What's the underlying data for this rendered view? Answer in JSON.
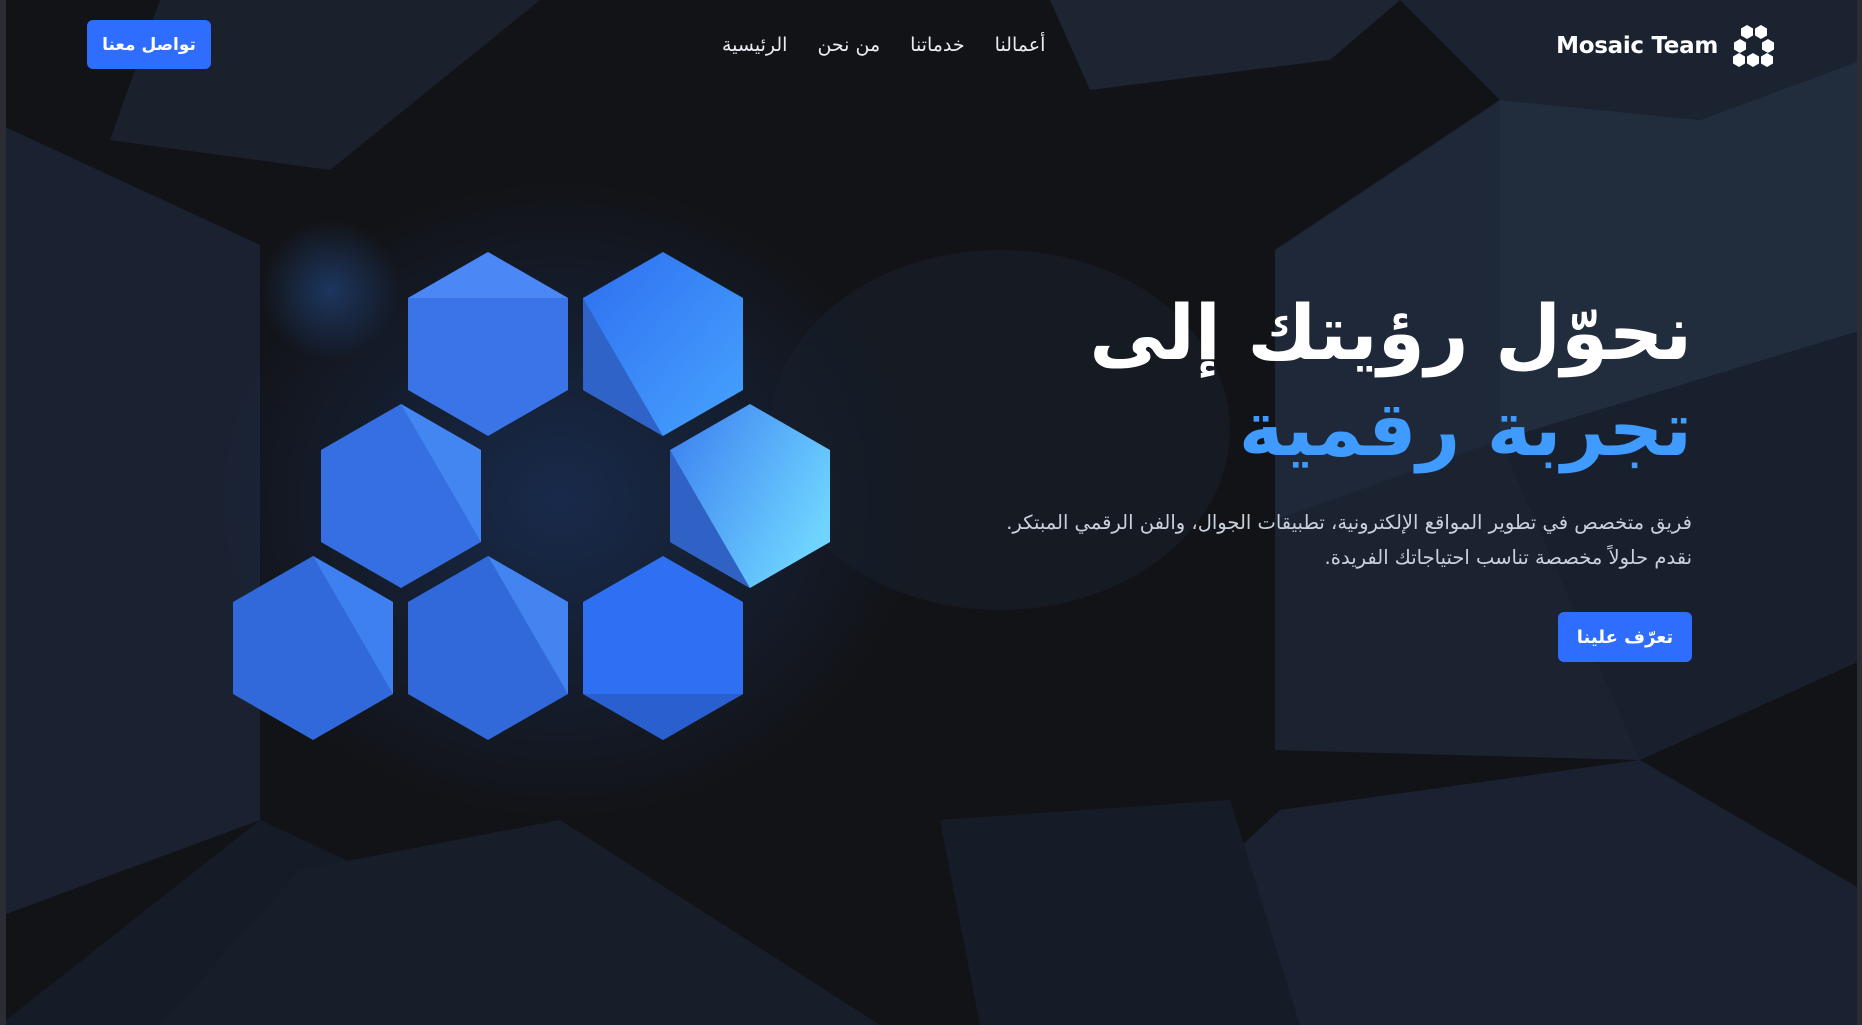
{
  "brand": {
    "name": "Mosaic Team",
    "logo_icon": "hexagon-cluster-icon"
  },
  "nav": {
    "links": [
      {
        "label": "الرئيسية"
      },
      {
        "label": "من نحن"
      },
      {
        "label": "خدماتنا"
      },
      {
        "label": "أعمالنا"
      }
    ],
    "contact_label": "تواصل معنا"
  },
  "hero": {
    "title_line1": "نحوّل رؤيتك إلى",
    "title_line2": "تجربة رقمية",
    "description": "فريق متخصص في تطوير المواقع الإلكترونية، تطبيقات الجوال، والفن الرقمي المبتكر. نقدم حلولاً مخصصة تناسب احتياجاتك الفريدة.",
    "cta_label": "تعرّف علينا"
  },
  "colors": {
    "accent": "#3f9bff",
    "button": "#2f6dff",
    "background": "#131417"
  }
}
